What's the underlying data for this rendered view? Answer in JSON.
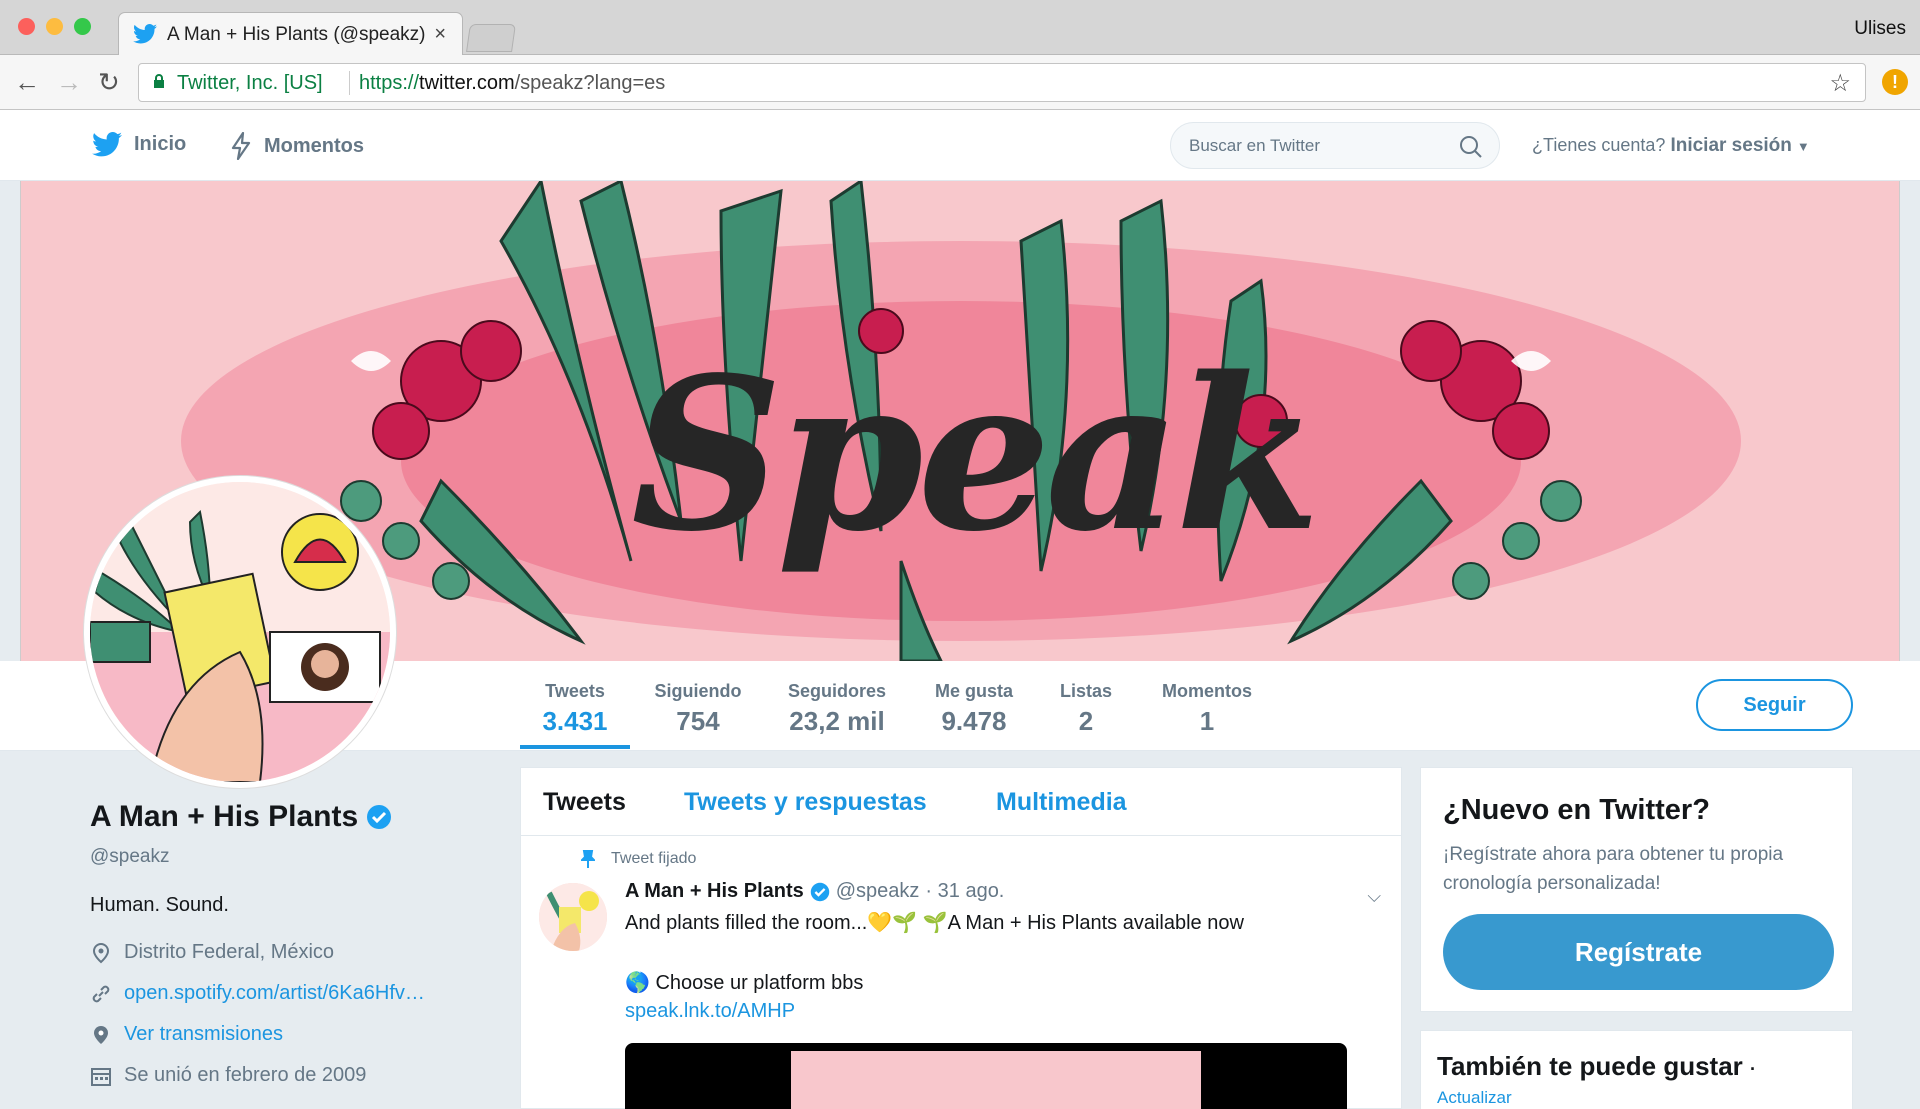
{
  "browser": {
    "tab_title": "A Man + His Plants (@speakz)",
    "close_symbol": "×",
    "user_name": "Ulises",
    "secure_label": "Twitter, Inc. [US]",
    "url_scheme": "https://",
    "url_host": "twitter.com",
    "url_path": "/speakz?lang=es",
    "extension_badge": "!"
  },
  "nav": {
    "home_label": "Inicio",
    "moments_label": "Momentos",
    "search_placeholder": "Buscar en Twitter",
    "account_prompt": "¿Tienes cuenta?",
    "login_label": "Iniciar sesión"
  },
  "banner": {
    "text": "Speak"
  },
  "stats": [
    {
      "label": "Tweets",
      "value": "3.431"
    },
    {
      "label": "Siguiendo",
      "value": "754"
    },
    {
      "label": "Seguidores",
      "value": "23,2 mil"
    },
    {
      "label": "Me gusta",
      "value": "9.478"
    },
    {
      "label": "Listas",
      "value": "2"
    },
    {
      "label": "Momentos",
      "value": "1"
    }
  ],
  "follow_label": "Seguir",
  "profile": {
    "name": "A Man + His Plants",
    "handle": "@speakz",
    "bio": "Human. Sound.",
    "location": "Distrito Federal, México",
    "website": "open.spotify.com/artist/6Ka6Hfv…",
    "streams": "Ver transmisiones",
    "joined": "Se unió en febrero de 2009"
  },
  "timeline": {
    "tabs": [
      "Tweets",
      "Tweets y respuestas",
      "Multimedia"
    ],
    "pinned_label": "Tweet fijado",
    "tweet": {
      "author": "A Man + His Plants",
      "handle": "@speakz",
      "date": "· 31 ago.",
      "text": "And plants filled the room...💛🌱 🌱A Man + His Plants available now",
      "line2": "🌎 Choose ur platform bbs",
      "link": "speak.lnk.to/AMHP"
    }
  },
  "sidebar": {
    "new_title": "¿Nuevo en Twitter?",
    "new_desc": "¡Regístrate ahora para obtener tu propia cronología personalizada!",
    "signup_label": "Regístrate",
    "suggest_title": "También te puede gustar",
    "suggest_dot": "·",
    "refresh_label": "Actualizar"
  },
  "colors": {
    "twitter_blue": "#1b95e0",
    "signup_button": "#3899cf",
    "verified_badge": "#1da1f2",
    "banner_pink": "#f8c8cc"
  }
}
